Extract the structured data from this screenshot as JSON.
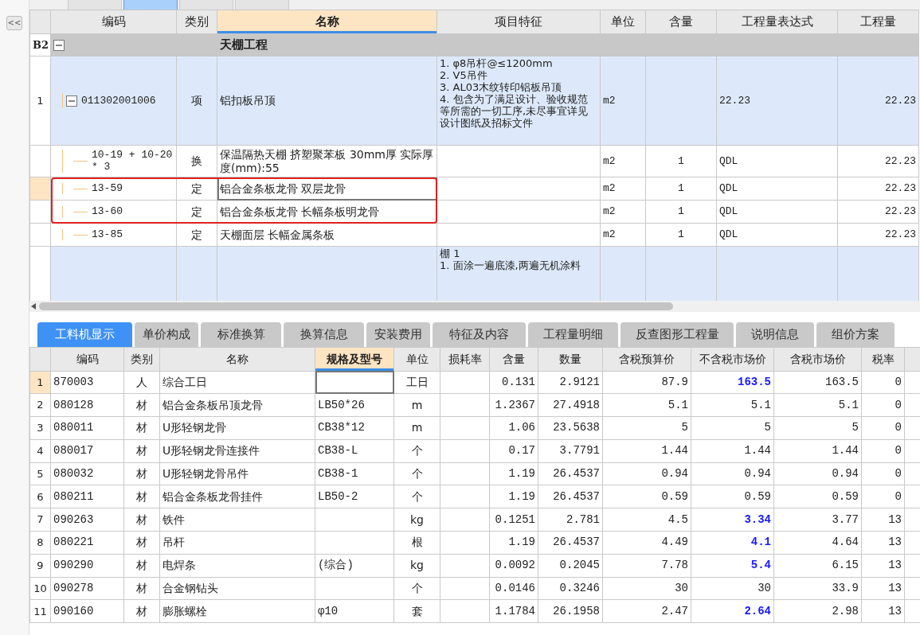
{
  "top_tabs": [
    {
      "selected": false
    },
    {
      "selected": true
    },
    {
      "selected": false
    },
    {
      "selected": false
    }
  ],
  "sidebar": {
    "collapse_button": "<<"
  },
  "bill_table": {
    "columns": [
      {
        "label": "编码",
        "selected": false
      },
      {
        "label": "类别",
        "selected": false
      },
      {
        "label": "名称",
        "selected": true
      },
      {
        "label": "项目特征",
        "selected": false
      },
      {
        "label": "单位",
        "selected": false
      },
      {
        "label": "含量",
        "selected": false
      },
      {
        "label": "工程量表达式",
        "selected": false
      },
      {
        "label": "工程量",
        "selected": false
      }
    ],
    "rows": [
      {
        "kind": "section",
        "num": "B2",
        "name": "天棚工程",
        "expanded": true,
        "children": [
          {
            "kind": "item",
            "num": "1",
            "code": "011302001006",
            "type": "项",
            "name": "铝扣板吊顶",
            "features": "1. φ8吊杆@≤1200mm\n2. V5吊件\n3. AL03木纹转印铝板吊顶\n4. 包含为了满足设计、验收规范等所需的一切工序,未尽事宜详见设计图纸及招标文件",
            "unit": "m2",
            "qty_expr": "22.23",
            "qty": "22.23",
            "expanded": true,
            "children": [
              {
                "kind": "quota",
                "code": "10-19 + 10-20 * 3",
                "type": "换",
                "name": "保温隔热天棚 挤塑聚苯板 30mm厚  实际厚度(mm):55",
                "unit": "m2",
                "content": "1",
                "qty_expr": "QDL",
                "qty": "22.23",
                "selected": false,
                "highlighted": false
              },
              {
                "kind": "quota",
                "code": "13-59",
                "type": "定",
                "name": "铝合金条板龙骨 双层龙骨",
                "unit": "m2",
                "content": "1",
                "qty_expr": "QDL",
                "qty": "22.23",
                "selected": true,
                "highlighted": true
              },
              {
                "kind": "quota",
                "code": "13-60",
                "type": "定",
                "name": "铝合金条板龙骨 长幅条板明龙骨",
                "unit": "m2",
                "content": "1",
                "qty_expr": "QDL",
                "qty": "22.23",
                "selected": false,
                "highlighted": true
              },
              {
                "kind": "quota",
                "code": "13-85",
                "type": "定",
                "name": "天棚面层 长幅金属条板",
                "unit": "m2",
                "content": "1",
                "qty_expr": "QDL",
                "qty": "22.23",
                "selected": false,
                "highlighted": false
              }
            ]
          },
          {
            "kind": "item",
            "features": "棚 1\n1. 面涂一遍底漆,两遍无机涂料"
          }
        ]
      }
    ]
  },
  "detail_tabs": [
    {
      "label": "工料机显示",
      "selected": true
    },
    {
      "label": "单价构成",
      "selected": false
    },
    {
      "label": "标准换算",
      "selected": false
    },
    {
      "label": "换算信息",
      "selected": false
    },
    {
      "label": "安装费用",
      "selected": false
    },
    {
      "label": "特征及内容",
      "selected": false
    },
    {
      "label": "工程量明细",
      "selected": false
    },
    {
      "label": "反查图形工程量",
      "selected": false
    },
    {
      "label": "说明信息",
      "selected": false
    },
    {
      "label": "组价方案",
      "selected": false
    }
  ],
  "resource_table": {
    "columns": [
      {
        "label": "编码",
        "selected": false
      },
      {
        "label": "类别",
        "selected": false
      },
      {
        "label": "名称",
        "selected": false
      },
      {
        "label": "规格及型号",
        "selected": true
      },
      {
        "label": "单位",
        "selected": false
      },
      {
        "label": "损耗率",
        "selected": false
      },
      {
        "label": "含量",
        "selected": false
      },
      {
        "label": "数量",
        "selected": false
      },
      {
        "label": "含税预算价",
        "selected": false
      },
      {
        "label": "不含税市场价",
        "selected": false
      },
      {
        "label": "含税市场价",
        "selected": false
      },
      {
        "label": "税率",
        "selected": false
      }
    ],
    "rows": [
      {
        "num": "1",
        "code": "870003",
        "type": "人",
        "name": "综合工日",
        "spec": "",
        "unit": "工日",
        "content": "0.131",
        "quantity": "2.9121",
        "budget_price": "87.9",
        "market_price": "163.5",
        "market_modified": true,
        "market_price_tax": "163.5",
        "tax_rate": "0",
        "selected": true
      },
      {
        "num": "2",
        "code": "080128",
        "type": "材",
        "name": "铝合金条板吊顶龙骨",
        "spec": "LB50*26",
        "unit": "m",
        "content": "1.2367",
        "quantity": "27.4918",
        "budget_price": "5.1",
        "market_price": "5.1",
        "market_modified": false,
        "market_price_tax": "5.1",
        "tax_rate": "0",
        "selected": false
      },
      {
        "num": "3",
        "code": "080011",
        "type": "材",
        "name": "U形轻钢龙骨",
        "spec": "CB38*12",
        "unit": "m",
        "content": "1.06",
        "quantity": "23.5638",
        "budget_price": "5",
        "market_price": "5",
        "market_modified": false,
        "market_price_tax": "5",
        "tax_rate": "0",
        "selected": false
      },
      {
        "num": "4",
        "code": "080017",
        "type": "材",
        "name": "U形轻钢龙骨连接件",
        "spec": "CB38-L",
        "unit": "个",
        "content": "0.17",
        "quantity": "3.7791",
        "budget_price": "1.44",
        "market_price": "1.44",
        "market_modified": false,
        "market_price_tax": "1.44",
        "tax_rate": "0",
        "selected": false
      },
      {
        "num": "5",
        "code": "080032",
        "type": "材",
        "name": "U形轻钢龙骨吊件",
        "spec": "CB38-1",
        "unit": "个",
        "content": "1.19",
        "quantity": "26.4537",
        "budget_price": "0.94",
        "market_price": "0.94",
        "market_modified": false,
        "market_price_tax": "0.94",
        "tax_rate": "0",
        "selected": false
      },
      {
        "num": "6",
        "code": "080211",
        "type": "材",
        "name": "铝合金条板龙骨挂件",
        "spec": "LB50-2",
        "unit": "个",
        "content": "1.19",
        "quantity": "26.4537",
        "budget_price": "0.59",
        "market_price": "0.59",
        "market_modified": false,
        "market_price_tax": "0.59",
        "tax_rate": "0",
        "selected": false
      },
      {
        "num": "7",
        "code": "090263",
        "type": "材",
        "name": "铁件",
        "spec": "",
        "unit": "kg",
        "content": "0.1251",
        "quantity": "2.781",
        "budget_price": "4.5",
        "market_price": "3.34",
        "market_modified": true,
        "market_price_tax": "3.77",
        "tax_rate": "13",
        "selected": false
      },
      {
        "num": "8",
        "code": "080221",
        "type": "材",
        "name": "吊杆",
        "spec": "",
        "unit": "根",
        "content": "1.19",
        "quantity": "26.4537",
        "budget_price": "4.49",
        "market_price": "4.1",
        "market_modified": true,
        "market_price_tax": "4.64",
        "tax_rate": "13",
        "selected": false
      },
      {
        "num": "9",
        "code": "090290",
        "type": "材",
        "name": "电焊条",
        "spec": "(综合)",
        "unit": "kg",
        "content": "0.0092",
        "quantity": "0.2045",
        "budget_price": "7.78",
        "market_price": "5.4",
        "market_modified": true,
        "market_price_tax": "6.15",
        "tax_rate": "13",
        "selected": false
      },
      {
        "num": "10",
        "code": "090278",
        "type": "材",
        "name": "合金钢钻头",
        "spec": "",
        "unit": "个",
        "content": "0.0146",
        "quantity": "0.3246",
        "budget_price": "30",
        "market_price": "30",
        "market_modified": false,
        "market_price_tax": "33.9",
        "tax_rate": "13",
        "selected": false
      },
      {
        "num": "11",
        "code": "090160",
        "type": "材",
        "name": "膨胀螺栓",
        "spec": "φ10",
        "unit": "套",
        "content": "1.1784",
        "quantity": "26.1958",
        "budget_price": "2.47",
        "market_price": "2.64",
        "market_modified": true,
        "market_price_tax": "2.98",
        "tax_rate": "13",
        "selected": false
      }
    ]
  }
}
